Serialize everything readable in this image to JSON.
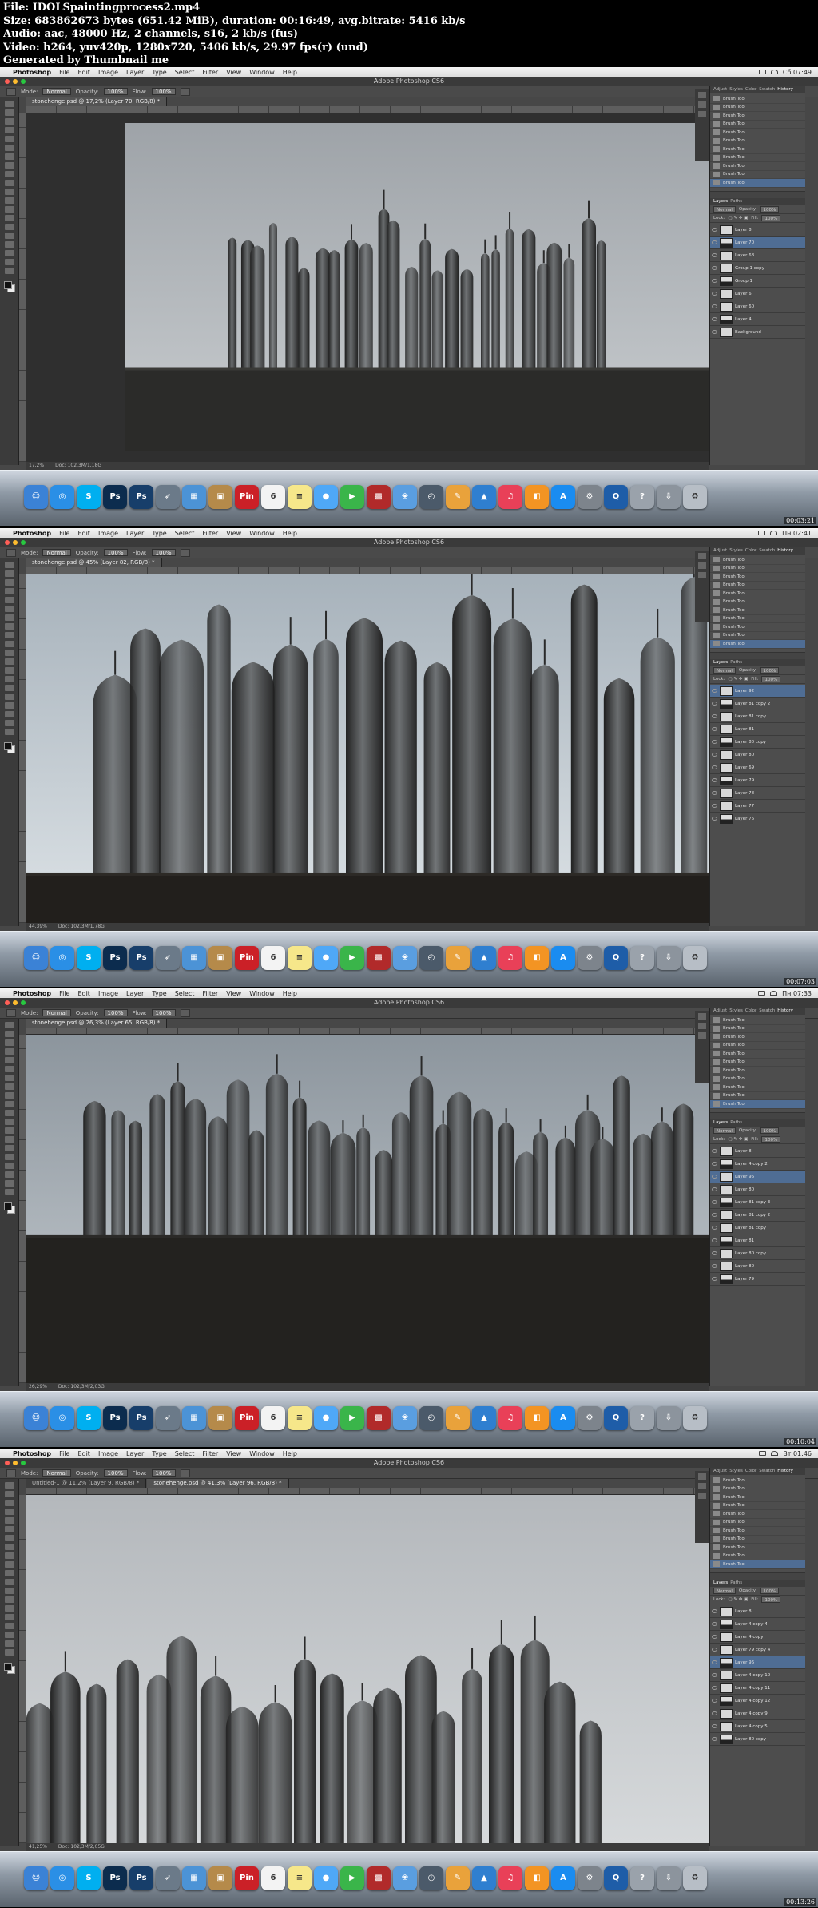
{
  "meta": {
    "lines": [
      "File: IDOLSpaintingprocess2.mp4",
      "Size: 683862673 bytes (651.42 MiB), duration: 00:16:49, avg.bitrate: 5416 kb/s",
      "Audio: aac, 48000 Hz, 2 channels, s16, 2 kb/s (fus)",
      "Video: h264, yuv420p, 1280x720, 5406 kb/s, 29.97 fps(r) (und)",
      "Generated by Thumbnail me"
    ]
  },
  "common": {
    "app_menu": [
      "Photoshop",
      "File",
      "Edit",
      "Image",
      "Layer",
      "Type",
      "Select",
      "Filter",
      "View",
      "Window",
      "Help"
    ],
    "window_title": "Adobe Photoshop CS6",
    "options": {
      "mode_label": "Mode:",
      "mode_value": "Normal",
      "opacity_label": "Opacity:",
      "opacity_value": "100%",
      "flow_label": "Flow:",
      "flow_value": "100%"
    },
    "panel_tabs": [
      "Adjust",
      "Styles",
      "Color",
      "Swatch",
      "History"
    ],
    "layer_tabs": [
      "Layers",
      "Paths"
    ],
    "blend_mode": "Normal",
    "opacity_label": "Opacity:",
    "opacity_value": "100%",
    "lock_label": "Lock:",
    "fill_label": "Fill:",
    "fill_value": "100%",
    "history_item": "Brush Tool",
    "colors": {
      "ps_gray": "#474747",
      "selection": "#4f6d94",
      "dock": "#8f9aa6"
    }
  },
  "frames": [
    {
      "clock": "Сб 07:49",
      "tabs": [
        "stonehenge.psd @ 17,2% (Layer 70, RGB/8) *"
      ],
      "status": "17,2%",
      "doc": "Doc: 102,3M/1,18G",
      "timestamp": "00:03:21",
      "layers": [
        {
          "name": "Layer 8"
        },
        {
          "name": "Layer 70",
          "selected": true
        },
        {
          "name": "Layer 68"
        },
        {
          "name": "Group 1 copy"
        },
        {
          "name": "Group 1"
        },
        {
          "name": "Layer 6"
        },
        {
          "name": "Layer 60"
        },
        {
          "name": "Layer 4"
        },
        {
          "name": "Background"
        }
      ]
    },
    {
      "clock": "Пн 02:41",
      "tabs": [
        "stonehenge.psd @ 45% (Layer 82, RGB/8) *"
      ],
      "status": "44,39%",
      "doc": "Doc: 102,3M/1,78G",
      "timestamp": "00:07:03",
      "layers": [
        {
          "name": "Layer 92",
          "selected": true
        },
        {
          "name": "Layer 81 copy 2"
        },
        {
          "name": "Layer 81 copy"
        },
        {
          "name": "Layer 81"
        },
        {
          "name": "Layer 80 copy"
        },
        {
          "name": "Layer 80"
        },
        {
          "name": "Layer 69"
        },
        {
          "name": "Layer 79"
        },
        {
          "name": "Layer 78"
        },
        {
          "name": "Layer 77"
        },
        {
          "name": "Layer 76"
        }
      ]
    },
    {
      "clock": "Пн 07:33",
      "tabs": [
        "stonehenge.psd @ 26,3% (Layer 65, RGB/8) *"
      ],
      "status": "26,29%",
      "doc": "Doc: 102,3M/2,03G",
      "timestamp": "00:10:04",
      "layers": [
        {
          "name": "Layer 8"
        },
        {
          "name": "Layer 4 copy 2"
        },
        {
          "name": "Layer 96",
          "selected": true
        },
        {
          "name": "Layer 80"
        },
        {
          "name": "Layer 81 copy 3"
        },
        {
          "name": "Layer 81 copy 2"
        },
        {
          "name": "Layer 81 copy"
        },
        {
          "name": "Layer 81"
        },
        {
          "name": "Layer 80 copy"
        },
        {
          "name": "Layer 80"
        },
        {
          "name": "Layer 79"
        }
      ]
    },
    {
      "clock": "Вт 01:46",
      "tabs": [
        "Untitled-1 @ 11,2% (Layer 9, RGB/8) *",
        "stonehenge.psd @ 41,3% (Layer 96, RGB/8) *"
      ],
      "status": "41,25%",
      "doc": "Doc: 102,3M/2,05G",
      "timestamp": "00:13:26",
      "layers": [
        {
          "name": "Layer 8"
        },
        {
          "name": "Layer 4 copy 4"
        },
        {
          "name": "Layer 4 copy"
        },
        {
          "name": "Layer 79 copy 4"
        },
        {
          "name": "Layer 96",
          "selected": true
        },
        {
          "name": "Layer 4 copy 10"
        },
        {
          "name": "Layer 4 copy 11"
        },
        {
          "name": "Layer 4 copy 12"
        },
        {
          "name": "Layer 4 copy 9"
        },
        {
          "name": "Layer 4 copy 5"
        },
        {
          "name": "Layer 80 copy"
        }
      ]
    }
  ],
  "dock_icons": [
    {
      "name": "finder-icon",
      "color": "#3b82d6",
      "glyph": "☺"
    },
    {
      "name": "safari-icon",
      "color": "#2a8fe6",
      "glyph": "◎"
    },
    {
      "name": "skype-icon",
      "color": "#00aff0",
      "glyph": "S"
    },
    {
      "name": "photoshop-icon",
      "color": "#0c2c4e",
      "glyph": "Ps"
    },
    {
      "name": "photoshop-2-icon",
      "color": "#173e6a",
      "glyph": "Ps"
    },
    {
      "name": "rocket-icon",
      "color": "#6b7a89",
      "glyph": "➶"
    },
    {
      "name": "preview-icon",
      "color": "#4c93d6",
      "glyph": "▦"
    },
    {
      "name": "archive-icon",
      "color": "#b58a4a",
      "glyph": "▣"
    },
    {
      "name": "pinterest-icon",
      "color": "#cb2027",
      "glyph": "Pin"
    },
    {
      "name": "calendar-icon",
      "color": "#f3f3f3",
      "glyph": "6",
      "dark": true
    },
    {
      "name": "notes-icon",
      "color": "#f6e78a",
      "glyph": "≡",
      "dark": true
    },
    {
      "name": "messages-icon",
      "color": "#4fa8f7",
      "glyph": "●"
    },
    {
      "name": "facetime-icon",
      "color": "#3ab54a",
      "glyph": "▶"
    },
    {
      "name": "photobooth-icon",
      "color": "#b12a2a",
      "glyph": "▩"
    },
    {
      "name": "iphoto-icon",
      "color": "#5a9ee0",
      "glyph": "❀"
    },
    {
      "name": "timemachine-icon",
      "color": "#4b5a6a",
      "glyph": "◴"
    },
    {
      "name": "pages-icon",
      "color": "#e9a23b",
      "glyph": "✎"
    },
    {
      "name": "keynote-icon",
      "color": "#2f7fd0",
      "glyph": "▲"
    },
    {
      "name": "itunes-icon",
      "color": "#e94058",
      "glyph": "♫"
    },
    {
      "name": "ibooks-icon",
      "color": "#f39423",
      "glyph": "◧"
    },
    {
      "name": "appstore-icon",
      "color": "#1a8cf0",
      "glyph": "A"
    },
    {
      "name": "preferences-icon",
      "color": "#7d848c",
      "glyph": "⚙"
    },
    {
      "name": "quicktime-icon",
      "color": "#1e5da8",
      "glyph": "Q"
    },
    {
      "name": "help-icon",
      "color": "#9aa2ab",
      "glyph": "?"
    },
    {
      "name": "downloads-icon",
      "color": "#8c949d",
      "glyph": "⇩"
    },
    {
      "name": "trash-icon",
      "color": "#b7bec6",
      "glyph": "♻",
      "dark": true
    }
  ]
}
